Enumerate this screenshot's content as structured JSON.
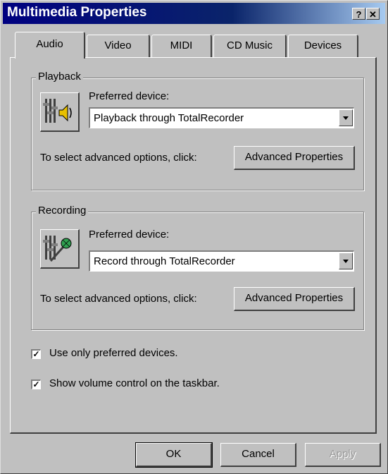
{
  "window": {
    "title": "Multimedia Properties",
    "help_button": "?",
    "close_button": "✕"
  },
  "tabs": [
    {
      "label": "Audio",
      "active": true
    },
    {
      "label": "Video",
      "active": false
    },
    {
      "label": "MIDI",
      "active": false
    },
    {
      "label": "CD Music",
      "active": false
    },
    {
      "label": "Devices",
      "active": false
    }
  ],
  "playback": {
    "group_label": "Playback",
    "preferred_label": "Preferred device:",
    "device_value": "Playback through TotalRecorder",
    "advanced_hint": "To select advanced options, click:",
    "advanced_button": "Advanced Properties",
    "icon": "speaker-icon"
  },
  "recording": {
    "group_label": "Recording",
    "preferred_label": "Preferred device:",
    "device_value": "Record through TotalRecorder",
    "advanced_hint": "To select advanced options, click:",
    "advanced_button": "Advanced Properties",
    "icon": "microphone-icon"
  },
  "options": {
    "use_only_preferred": {
      "label": "Use only preferred devices.",
      "checked": true
    },
    "show_volume": {
      "label": "Show volume control on the taskbar.",
      "checked": true
    }
  },
  "footer": {
    "ok": "OK",
    "cancel": "Cancel",
    "apply": "Apply"
  },
  "colors": {
    "title_start": "#000080",
    "title_end": "#a6caf0",
    "face": "#c0c0c0"
  }
}
